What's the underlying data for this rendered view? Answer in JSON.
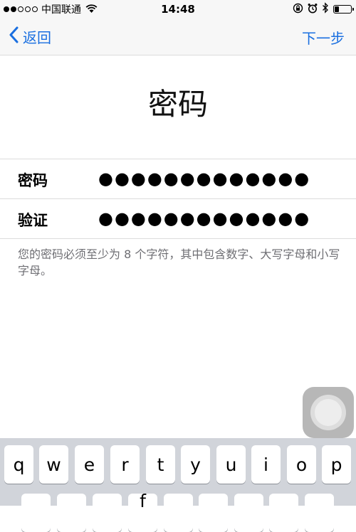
{
  "status_bar": {
    "carrier": "中国联通",
    "time": "14:48",
    "signal_bars": 2,
    "signal_total": 5,
    "battery_level": 0.3,
    "icons": [
      "wifi-icon",
      "orientation-lock-icon",
      "alarm-icon",
      "bluetooth-icon",
      "battery-icon"
    ]
  },
  "nav": {
    "back_label": "返回",
    "next_label": "下一步"
  },
  "page": {
    "title": "密码"
  },
  "form": {
    "password_label": "密码",
    "password_value": "●●●●●●●●●●●●●",
    "verify_label": "验证",
    "verify_value": "●●●●●●●●●●●●●"
  },
  "hint": "您的密码必须至少为 8 个字符，其中包含数字、大写字母和小写字母。",
  "keyboard": {
    "row1": [
      "q",
      "w",
      "e",
      "r",
      "t",
      "y",
      "u",
      "i",
      "o",
      "p"
    ],
    "row2_visible": [
      "f"
    ]
  },
  "colors": {
    "accent": "#1a6fe0",
    "bar_bg": "#f7f7f7",
    "keyboard_bg": "#d1d4da",
    "hint_text": "#6e6e73"
  }
}
